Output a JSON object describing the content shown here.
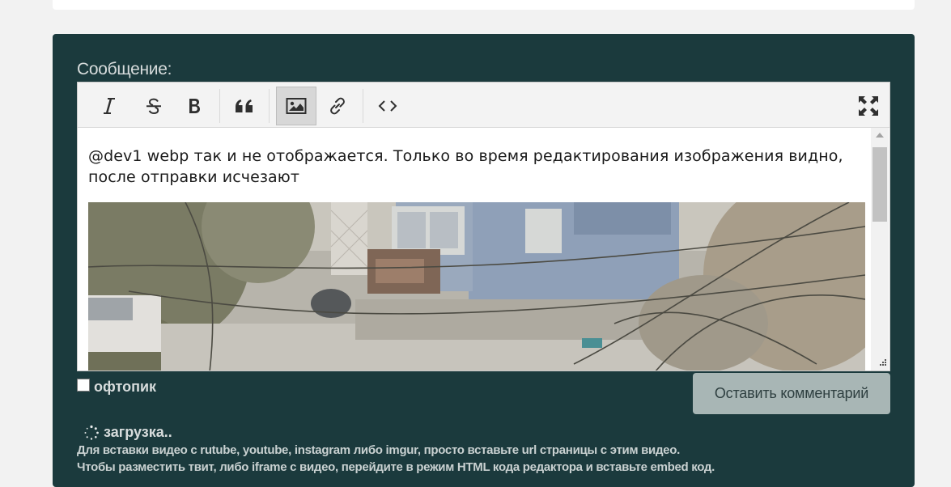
{
  "form": {
    "message_label": "Сообщение:",
    "offtopic_label": "офтопик",
    "submit_label": "Оставить комментарий",
    "loading_label": "загрузка..",
    "hint_line1": "Для вставки видео с rutube, youtube, instagram либо imgur, просто вставьте url страницы с этим видео.",
    "hint_line2": "Чтобы разместить твит, либо iframe с видео, перейдите в режим HTML кода редактора и вставьте embed код."
  },
  "editor": {
    "content_text": "@dev1 webp так и не отображается. Только во время редактирования изображения видно, после отправки исчезают",
    "toolbar": [
      {
        "name": "italic-button",
        "icon": "italic-icon"
      },
      {
        "name": "strikethrough-button",
        "icon": "strikethrough-icon"
      },
      {
        "name": "bold-button",
        "icon": "bold-icon"
      },
      {
        "name": "quote-button",
        "icon": "quote-icon"
      },
      {
        "name": "image-button",
        "icon": "image-icon",
        "active": true
      },
      {
        "name": "link-button",
        "icon": "link-icon"
      },
      {
        "name": "code-button",
        "icon": "code-icon"
      },
      {
        "name": "fullscreen-button",
        "icon": "fullscreen-icon"
      }
    ]
  },
  "colors": {
    "panel_bg": "#1b3a3d",
    "button_bg": "#a8b6b5",
    "label_text": "#d7dcdc"
  }
}
